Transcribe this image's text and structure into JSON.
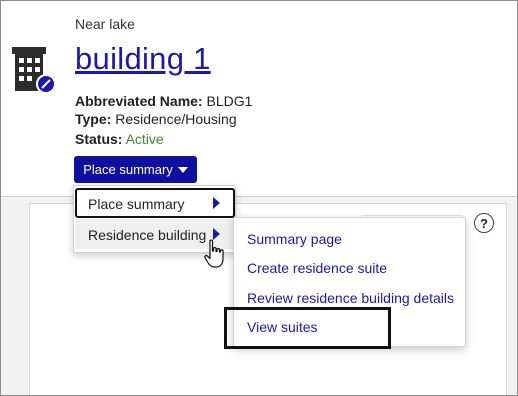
{
  "header": {
    "location": "Near lake",
    "title": "building 1",
    "fields": {
      "abbreviated_name_label": "Abbreviated Name:",
      "abbreviated_name_value": "BLDG1",
      "type_label": "Type:",
      "type_value": "Residence/Housing",
      "status_label": "Status:",
      "status_value": "Active"
    },
    "place_button_label": "Place summary",
    "icon": "building-icon"
  },
  "menu_primary": {
    "items": [
      {
        "label": "Place summary",
        "icon": "chevron-right-icon"
      },
      {
        "label": "Residence building",
        "icon": "chevron-right-icon"
      }
    ]
  },
  "menu_secondary": {
    "items": [
      {
        "label": "Summary page"
      },
      {
        "label": "Create residence suite"
      },
      {
        "label": "Review residence building details"
      },
      {
        "label": "View suites"
      }
    ]
  },
  "panel": {
    "help_label": "?"
  },
  "colors": {
    "accent": "#0f0fa0",
    "link": "#1a1aa6",
    "status_active": "#3e8a2e"
  }
}
